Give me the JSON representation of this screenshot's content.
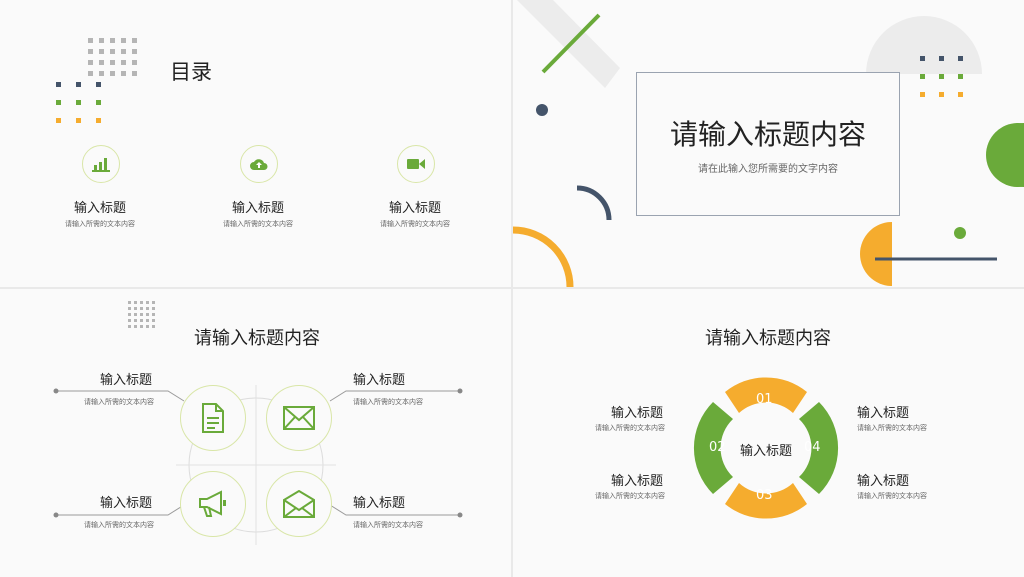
{
  "colors": {
    "green": "#6aaa3a",
    "orange": "#f5ac2e",
    "navy": "#44546a",
    "gray": "#bdbdbd"
  },
  "slide1": {
    "title": "目录",
    "items": [
      {
        "title": "输入标题",
        "desc": "请输入所需的文本内容",
        "icon": "bar-chart-icon"
      },
      {
        "title": "输入标题",
        "desc": "请输入所需的文本内容",
        "icon": "cloud-upload-icon"
      },
      {
        "title": "输入标题",
        "desc": "请输入所需的文本内容",
        "icon": "video-camera-icon"
      }
    ]
  },
  "slide2": {
    "title": "请输入标题内容",
    "subtitle": "请在此输入您所需要的文字内容"
  },
  "slide3": {
    "title": "请输入标题内容",
    "items": [
      {
        "title": "输入标题",
        "desc": "请输入所需的文本内容",
        "icon": "document-icon"
      },
      {
        "title": "输入标题",
        "desc": "请输入所需的文本内容",
        "icon": "mail-icon"
      },
      {
        "title": "输入标题",
        "desc": "请输入所需的文本内容",
        "icon": "megaphone-icon"
      },
      {
        "title": "输入标题",
        "desc": "请输入所需的文本内容",
        "icon": "envelope-icon"
      }
    ]
  },
  "slide4": {
    "title": "请输入标题内容",
    "center": "输入标题",
    "segments": [
      "01",
      "02",
      "03",
      "04"
    ],
    "items": [
      {
        "title": "输入标题",
        "desc": "请输入所需的文本内容"
      },
      {
        "title": "输入标题",
        "desc": "请输入所需的文本内容"
      },
      {
        "title": "输入标题",
        "desc": "请输入所需的文本内容"
      },
      {
        "title": "输入标题",
        "desc": "请输入所需的文本内容"
      }
    ]
  }
}
